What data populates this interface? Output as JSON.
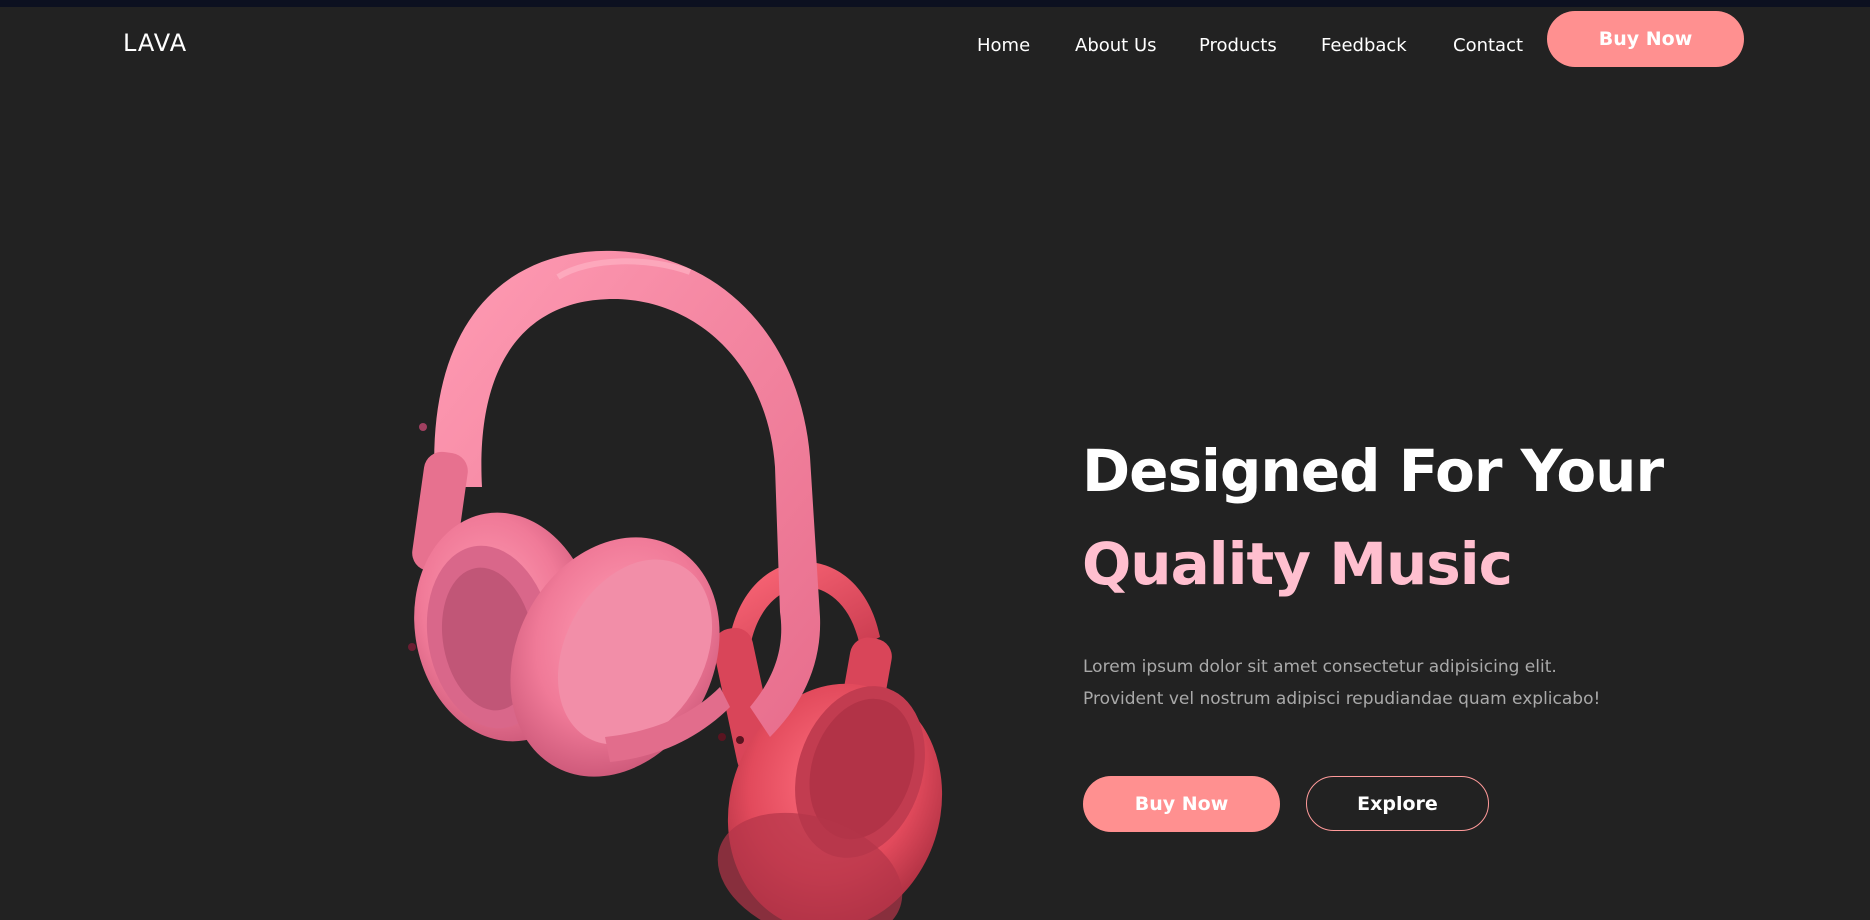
{
  "brand": {
    "logo": "LAVA"
  },
  "nav": {
    "links": [
      "Home",
      "About Us",
      "Products",
      "Feedback",
      "Contact"
    ],
    "cta_label": "Buy Now"
  },
  "hero": {
    "headline_line1": "Designed For Your",
    "headline_line2": "Quality Music",
    "description": "Lorem ipsum dolor sit amet consectetur adipisicing elit. Provident vel nostrum adipisci repudiandae quam explicabo!",
    "buy_label": "Buy Now",
    "explore_label": "Explore",
    "image_icon": "pink-headphones-photo"
  },
  "colors": {
    "background": "#222222",
    "accent": "#ff9090",
    "headline_accent": "#ffbfcf",
    "body_text": "#a9a9a9"
  }
}
